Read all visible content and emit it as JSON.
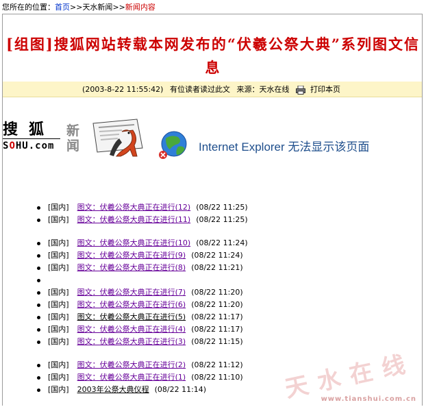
{
  "breadcrumb": {
    "prefix": "您所在的位置：",
    "home": "首页",
    "sep1": ">>",
    "section": "天水新闻",
    "sep2": ">>",
    "current": "新闻内容"
  },
  "article": {
    "title": "[组图]搜狐网站转载本网发布的“伏羲公祭大典”系列图文信息",
    "date": "(2003-8-22 11:55:42)",
    "readers": "有位读者读过此文",
    "source": "来源：天水在线",
    "print_label": "打印本页"
  },
  "embed": {
    "sohu_cn": "搜狐",
    "sohu_en_prefix": "S",
    "sohu_en_o": "O",
    "sohu_en_suffix": "HU.com",
    "news_label": "新闻",
    "ie_message": "Internet Explorer 无法显示该页面"
  },
  "news_items": [
    {
      "category": "[国内]",
      "title": "图文：伏羲公祭大典正在进行(12)",
      "time": "(08/22 11:25)"
    },
    {
      "category": "[国内]",
      "title": "图文：伏羲公祭大典正在进行(11)",
      "time": "(08/22 11:25)"
    },
    {
      "category": "[国内]",
      "title": "图文：伏羲公祭大典正在进行(10)",
      "time": "(08/22 11:24)"
    },
    {
      "category": "[国内]",
      "title": "图文：伏羲公祭大典正在进行(9)",
      "time": "(08/22 11:24)"
    },
    {
      "category": "[国内]",
      "title": "图文：伏羲公祭大典正在进行(8)",
      "time": "(08/22 11:21)"
    },
    {
      "category": "",
      "title": "",
      "time": ""
    },
    {
      "category": "[国内]",
      "title": "图文：伏羲公祭大典正在进行(7)",
      "time": "(08/22 11:20)"
    },
    {
      "category": "[国内]",
      "title": "图文：伏羲公祭大典正在进行(6)",
      "time": "(08/22 11:20)"
    },
    {
      "category": "[国内]",
      "title": "图文：伏羲公祭大典正在进行(5)",
      "time": "(08/22 11:17)"
    },
    {
      "category": "[国内]",
      "title": "图文：伏羲公祭大典正在进行(4)",
      "time": "(08/22 11:17)"
    },
    {
      "category": "[国内]",
      "title": "图文：伏羲公祭大典正在进行(3)",
      "time": "(08/22 11:15)"
    },
    {
      "category": "[国内]",
      "title": "图文：伏羲公祭大典正在进行(2)",
      "time": "(08/22 11:12)"
    },
    {
      "category": "[国内]",
      "title": "图文：伏羲公祭大典正在进行(1)",
      "time": "(08/22 11:10)"
    },
    {
      "category": "[国内]",
      "title": "2003年公祭大典仪程",
      "time": "(08/22 11:14)"
    }
  ],
  "watermark": {
    "text": "天水在线",
    "url": "www.tianshui.com.cn"
  },
  "colors": {
    "title_red": "#cc0000",
    "link_blue": "#0033cc",
    "visited_purple": "#660099",
    "infobar_bg": "#fdf5c8"
  }
}
